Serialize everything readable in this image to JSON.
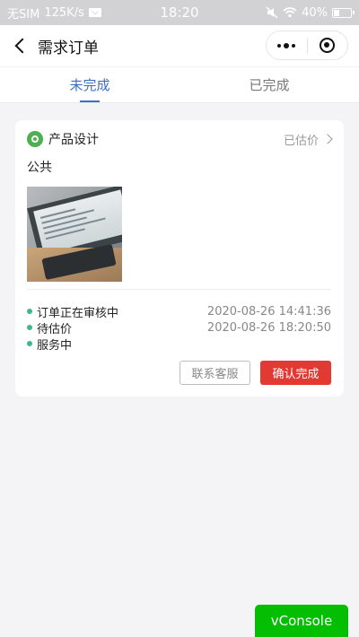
{
  "status_bar": {
    "carrier": "无SIM",
    "speed": "125K/s",
    "time": "18:20",
    "battery": "40%",
    "battery_level": 0.4
  },
  "nav": {
    "title": "需求订单"
  },
  "tabs": [
    {
      "label": "未完成",
      "active": true
    },
    {
      "label": "已完成",
      "active": false
    }
  ],
  "orders": [
    {
      "category": "产品设计",
      "status": "已估价",
      "description": "公共",
      "timeline": [
        {
          "label": "订单正在审核中",
          "time": "2020-08-26 14:41:36"
        },
        {
          "label": "待估价",
          "time": "2020-08-26 18:20:50"
        },
        {
          "label": "服务中",
          "time": ""
        }
      ],
      "secondary_action": "联系客服",
      "primary_action": "确认完成"
    }
  ],
  "vconsole": {
    "label": "vConsole"
  },
  "colors": {
    "accent": "#3a6fc4",
    "danger": "#e23a32",
    "success": "#3fb68b",
    "vconsole": "#04be02"
  }
}
